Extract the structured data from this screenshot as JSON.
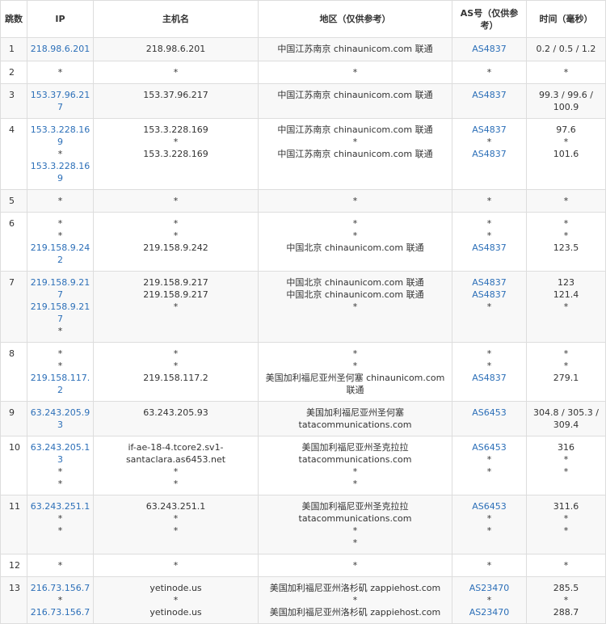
{
  "headers": {
    "hop": "跳数",
    "ip": "IP",
    "host": "主机名",
    "region": "地区（仅供参考）",
    "as": "AS号（仅供参考）",
    "time": "时间（毫秒）"
  },
  "rows": [
    {
      "hop": "1",
      "ip": [
        "218.98.6.201"
      ],
      "host": [
        "218.98.6.201"
      ],
      "region": [
        "中国江苏南京 chinaunicom.com 联通"
      ],
      "as": [
        "AS4837"
      ],
      "time": [
        "0.2 / 0.5 / 1.2"
      ]
    },
    {
      "hop": "2",
      "ip": [
        "*"
      ],
      "host": [
        "*"
      ],
      "region": [
        "*"
      ],
      "as": [
        "*"
      ],
      "time": [
        "*"
      ]
    },
    {
      "hop": "3",
      "ip": [
        "153.37.96.217"
      ],
      "host": [
        "153.37.96.217"
      ],
      "region": [
        "中国江苏南京 chinaunicom.com 联通"
      ],
      "as": [
        "AS4837"
      ],
      "time": [
        "99.3 / 99.6 / 100.9"
      ]
    },
    {
      "hop": "4",
      "ip": [
        "153.3.228.169",
        "*",
        "153.3.228.169"
      ],
      "host": [
        "153.3.228.169",
        "*",
        "153.3.228.169"
      ],
      "region": [
        "中国江苏南京 chinaunicom.com 联通",
        "*",
        "中国江苏南京 chinaunicom.com 联通"
      ],
      "as": [
        "AS4837",
        "*",
        "AS4837"
      ],
      "time": [
        "97.6",
        "*",
        "101.6"
      ]
    },
    {
      "hop": "5",
      "ip": [
        "*"
      ],
      "host": [
        "*"
      ],
      "region": [
        "*"
      ],
      "as": [
        "*"
      ],
      "time": [
        "*"
      ]
    },
    {
      "hop": "6",
      "ip": [
        "*",
        "*",
        "219.158.9.242"
      ],
      "host": [
        "*",
        "*",
        "219.158.9.242"
      ],
      "region": [
        "*",
        "*",
        "中国北京 chinaunicom.com 联通"
      ],
      "as": [
        "*",
        "*",
        "AS4837"
      ],
      "time": [
        "*",
        "*",
        "123.5"
      ]
    },
    {
      "hop": "7",
      "ip": [
        "219.158.9.217",
        "219.158.9.217",
        "*"
      ],
      "host": [
        "219.158.9.217",
        "219.158.9.217",
        "*"
      ],
      "region": [
        "中国北京 chinaunicom.com 联通",
        "中国北京 chinaunicom.com 联通",
        "*"
      ],
      "as": [
        "AS4837",
        "AS4837",
        "*"
      ],
      "time": [
        "123",
        "121.4",
        "*"
      ]
    },
    {
      "hop": "8",
      "ip": [
        "*",
        "*",
        "219.158.117.2"
      ],
      "host": [
        "*",
        "*",
        "219.158.117.2"
      ],
      "region": [
        "*",
        "*",
        "美国加利福尼亚州圣何塞 chinaunicom.com 联通"
      ],
      "as": [
        "*",
        "*",
        "AS4837"
      ],
      "time": [
        "*",
        "*",
        "279.1"
      ]
    },
    {
      "hop": "9",
      "ip": [
        "63.243.205.93"
      ],
      "host": [
        "63.243.205.93"
      ],
      "region": [
        "美国加利福尼亚州圣何塞 tatacommunications.com"
      ],
      "as": [
        "AS6453"
      ],
      "time": [
        "304.8 / 305.3 / 309.4"
      ]
    },
    {
      "hop": "10",
      "ip": [
        "63.243.205.13",
        "*",
        "*"
      ],
      "host": [
        "if-ae-18-4.tcore2.sv1-santaclara.as6453.net",
        "*",
        "*"
      ],
      "region": [
        "美国加利福尼亚州圣克拉拉 tatacommunications.com",
        "*",
        "*"
      ],
      "as": [
        "AS6453",
        "*",
        "*"
      ],
      "time": [
        "316",
        "*",
        "*"
      ]
    },
    {
      "hop": "11",
      "ip": [
        "63.243.251.1",
        "*",
        "*"
      ],
      "host": [
        "63.243.251.1",
        "*",
        "*"
      ],
      "region": [
        "美国加利福尼亚州圣克拉拉 tatacommunications.com",
        "*",
        "*"
      ],
      "as": [
        "AS6453",
        "*",
        "*"
      ],
      "time": [
        "311.6",
        "*",
        "*"
      ]
    },
    {
      "hop": "12",
      "ip": [
        "*"
      ],
      "host": [
        "*"
      ],
      "region": [
        "*"
      ],
      "as": [
        "*"
      ],
      "time": [
        "*"
      ]
    },
    {
      "hop": "13",
      "ip": [
        "216.73.156.7",
        "*",
        "216.73.156.7"
      ],
      "host": [
        "yetinode.us",
        "*",
        "yetinode.us"
      ],
      "region": [
        "美国加利福尼亚州洛杉矶 zappiehost.com",
        "*",
        "美国加利福尼亚州洛杉矶 zappiehost.com"
      ],
      "as": [
        "AS23470",
        "*",
        "AS23470"
      ],
      "time": [
        "285.5",
        "*",
        "288.7"
      ]
    }
  ]
}
